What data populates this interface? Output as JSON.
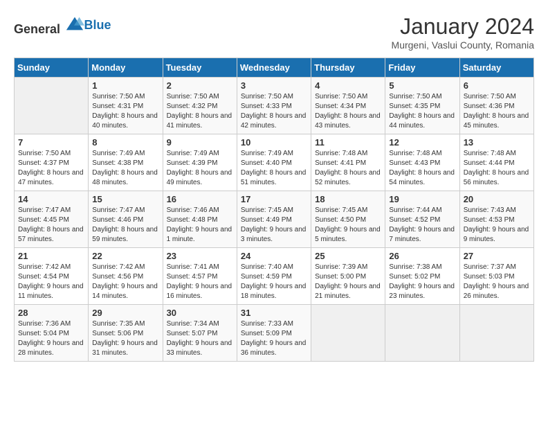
{
  "logo": {
    "general": "General",
    "blue": "Blue"
  },
  "header": {
    "title": "January 2024",
    "subtitle": "Murgeni, Vaslui County, Romania"
  },
  "weekdays": [
    "Sunday",
    "Monday",
    "Tuesday",
    "Wednesday",
    "Thursday",
    "Friday",
    "Saturday"
  ],
  "weeks": [
    [
      {
        "day": "",
        "sunrise": "",
        "sunset": "",
        "daylight": ""
      },
      {
        "day": "1",
        "sunrise": "Sunrise: 7:50 AM",
        "sunset": "Sunset: 4:31 PM",
        "daylight": "Daylight: 8 hours and 40 minutes."
      },
      {
        "day": "2",
        "sunrise": "Sunrise: 7:50 AM",
        "sunset": "Sunset: 4:32 PM",
        "daylight": "Daylight: 8 hours and 41 minutes."
      },
      {
        "day": "3",
        "sunrise": "Sunrise: 7:50 AM",
        "sunset": "Sunset: 4:33 PM",
        "daylight": "Daylight: 8 hours and 42 minutes."
      },
      {
        "day": "4",
        "sunrise": "Sunrise: 7:50 AM",
        "sunset": "Sunset: 4:34 PM",
        "daylight": "Daylight: 8 hours and 43 minutes."
      },
      {
        "day": "5",
        "sunrise": "Sunrise: 7:50 AM",
        "sunset": "Sunset: 4:35 PM",
        "daylight": "Daylight: 8 hours and 44 minutes."
      },
      {
        "day": "6",
        "sunrise": "Sunrise: 7:50 AM",
        "sunset": "Sunset: 4:36 PM",
        "daylight": "Daylight: 8 hours and 45 minutes."
      }
    ],
    [
      {
        "day": "7",
        "sunrise": "Sunrise: 7:50 AM",
        "sunset": "Sunset: 4:37 PM",
        "daylight": "Daylight: 8 hours and 47 minutes."
      },
      {
        "day": "8",
        "sunrise": "Sunrise: 7:49 AM",
        "sunset": "Sunset: 4:38 PM",
        "daylight": "Daylight: 8 hours and 48 minutes."
      },
      {
        "day": "9",
        "sunrise": "Sunrise: 7:49 AM",
        "sunset": "Sunset: 4:39 PM",
        "daylight": "Daylight: 8 hours and 49 minutes."
      },
      {
        "day": "10",
        "sunrise": "Sunrise: 7:49 AM",
        "sunset": "Sunset: 4:40 PM",
        "daylight": "Daylight: 8 hours and 51 minutes."
      },
      {
        "day": "11",
        "sunrise": "Sunrise: 7:48 AM",
        "sunset": "Sunset: 4:41 PM",
        "daylight": "Daylight: 8 hours and 52 minutes."
      },
      {
        "day": "12",
        "sunrise": "Sunrise: 7:48 AM",
        "sunset": "Sunset: 4:43 PM",
        "daylight": "Daylight: 8 hours and 54 minutes."
      },
      {
        "day": "13",
        "sunrise": "Sunrise: 7:48 AM",
        "sunset": "Sunset: 4:44 PM",
        "daylight": "Daylight: 8 hours and 56 minutes."
      }
    ],
    [
      {
        "day": "14",
        "sunrise": "Sunrise: 7:47 AM",
        "sunset": "Sunset: 4:45 PM",
        "daylight": "Daylight: 8 hours and 57 minutes."
      },
      {
        "day": "15",
        "sunrise": "Sunrise: 7:47 AM",
        "sunset": "Sunset: 4:46 PM",
        "daylight": "Daylight: 8 hours and 59 minutes."
      },
      {
        "day": "16",
        "sunrise": "Sunrise: 7:46 AM",
        "sunset": "Sunset: 4:48 PM",
        "daylight": "Daylight: 9 hours and 1 minute."
      },
      {
        "day": "17",
        "sunrise": "Sunrise: 7:45 AM",
        "sunset": "Sunset: 4:49 PM",
        "daylight": "Daylight: 9 hours and 3 minutes."
      },
      {
        "day": "18",
        "sunrise": "Sunrise: 7:45 AM",
        "sunset": "Sunset: 4:50 PM",
        "daylight": "Daylight: 9 hours and 5 minutes."
      },
      {
        "day": "19",
        "sunrise": "Sunrise: 7:44 AM",
        "sunset": "Sunset: 4:52 PM",
        "daylight": "Daylight: 9 hours and 7 minutes."
      },
      {
        "day": "20",
        "sunrise": "Sunrise: 7:43 AM",
        "sunset": "Sunset: 4:53 PM",
        "daylight": "Daylight: 9 hours and 9 minutes."
      }
    ],
    [
      {
        "day": "21",
        "sunrise": "Sunrise: 7:42 AM",
        "sunset": "Sunset: 4:54 PM",
        "daylight": "Daylight: 9 hours and 11 minutes."
      },
      {
        "day": "22",
        "sunrise": "Sunrise: 7:42 AM",
        "sunset": "Sunset: 4:56 PM",
        "daylight": "Daylight: 9 hours and 14 minutes."
      },
      {
        "day": "23",
        "sunrise": "Sunrise: 7:41 AM",
        "sunset": "Sunset: 4:57 PM",
        "daylight": "Daylight: 9 hours and 16 minutes."
      },
      {
        "day": "24",
        "sunrise": "Sunrise: 7:40 AM",
        "sunset": "Sunset: 4:59 PM",
        "daylight": "Daylight: 9 hours and 18 minutes."
      },
      {
        "day": "25",
        "sunrise": "Sunrise: 7:39 AM",
        "sunset": "Sunset: 5:00 PM",
        "daylight": "Daylight: 9 hours and 21 minutes."
      },
      {
        "day": "26",
        "sunrise": "Sunrise: 7:38 AM",
        "sunset": "Sunset: 5:02 PM",
        "daylight": "Daylight: 9 hours and 23 minutes."
      },
      {
        "day": "27",
        "sunrise": "Sunrise: 7:37 AM",
        "sunset": "Sunset: 5:03 PM",
        "daylight": "Daylight: 9 hours and 26 minutes."
      }
    ],
    [
      {
        "day": "28",
        "sunrise": "Sunrise: 7:36 AM",
        "sunset": "Sunset: 5:04 PM",
        "daylight": "Daylight: 9 hours and 28 minutes."
      },
      {
        "day": "29",
        "sunrise": "Sunrise: 7:35 AM",
        "sunset": "Sunset: 5:06 PM",
        "daylight": "Daylight: 9 hours and 31 minutes."
      },
      {
        "day": "30",
        "sunrise": "Sunrise: 7:34 AM",
        "sunset": "Sunset: 5:07 PM",
        "daylight": "Daylight: 9 hours and 33 minutes."
      },
      {
        "day": "31",
        "sunrise": "Sunrise: 7:33 AM",
        "sunset": "Sunset: 5:09 PM",
        "daylight": "Daylight: 9 hours and 36 minutes."
      },
      {
        "day": "",
        "sunrise": "",
        "sunset": "",
        "daylight": ""
      },
      {
        "day": "",
        "sunrise": "",
        "sunset": "",
        "daylight": ""
      },
      {
        "day": "",
        "sunrise": "",
        "sunset": "",
        "daylight": ""
      }
    ]
  ]
}
